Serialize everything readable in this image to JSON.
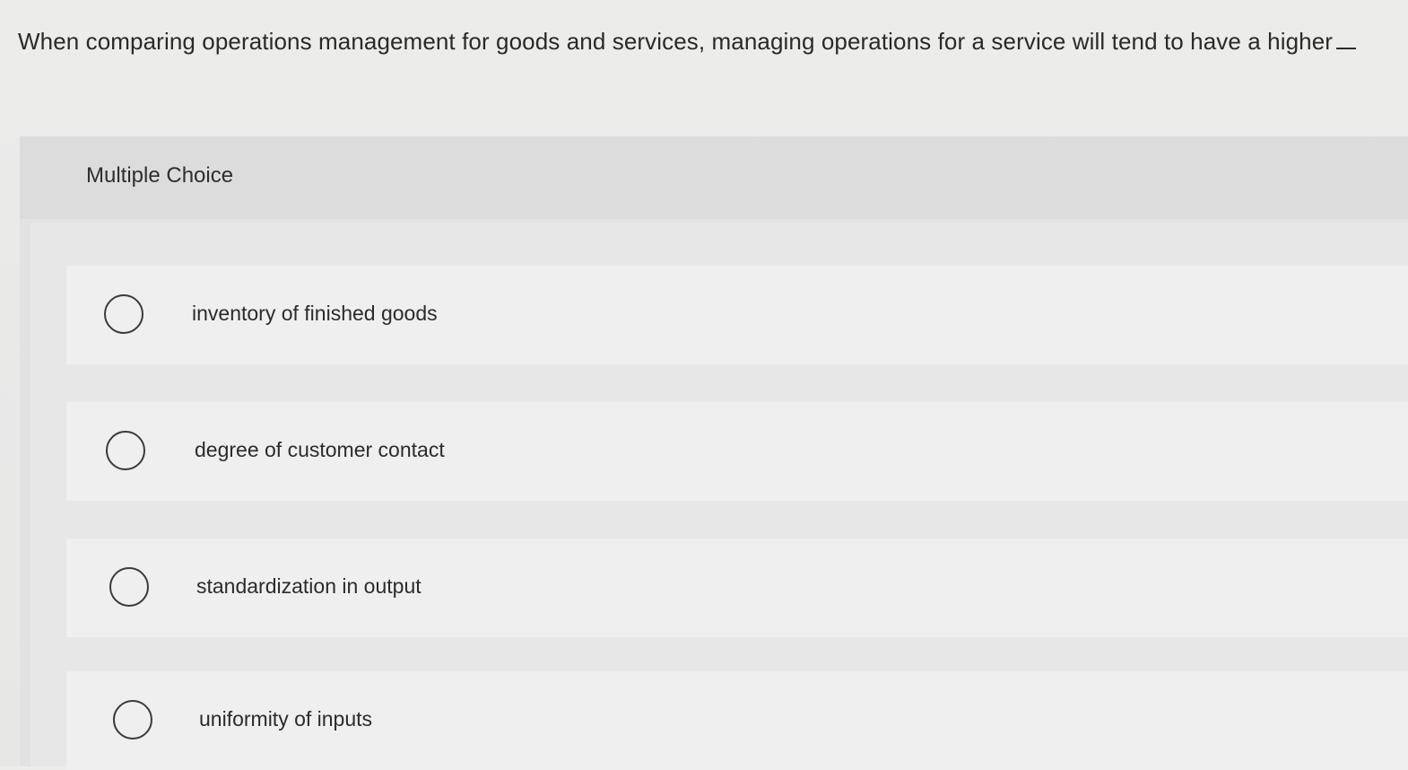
{
  "question": {
    "text": "When comparing operations management for goods and services, managing operations for a service will tend to have a higher"
  },
  "multiple_choice": {
    "label": "Multiple Choice",
    "options": [
      {
        "label": "inventory of finished goods"
      },
      {
        "label": "degree of customer contact"
      },
      {
        "label": "standardization in output"
      },
      {
        "label": "uniformity of inputs"
      }
    ]
  },
  "colors": {
    "background": "#e9e9e8",
    "panel": "#e1e2e1",
    "option_row": "#eeefee",
    "text": "#2b2b2b"
  }
}
